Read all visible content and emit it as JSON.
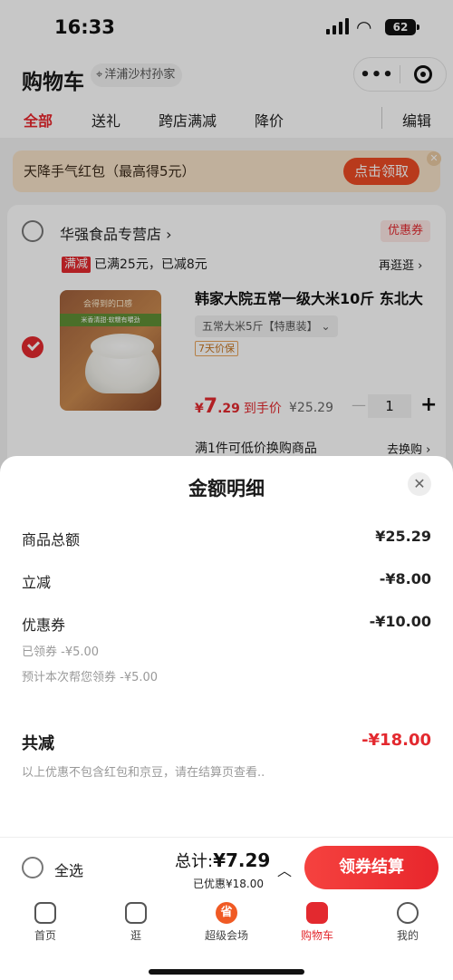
{
  "status_bar": {
    "time": "16:33",
    "battery": "62"
  },
  "header": {
    "title": "购物车",
    "location": "洋浦沙村孙家",
    "tabs": [
      {
        "label": "全部",
        "active": true
      },
      {
        "label": "送礼"
      },
      {
        "label": "跨店满减"
      },
      {
        "label": "降价"
      }
    ],
    "edit_label": "编辑"
  },
  "promo_banner": {
    "text": "天降手气红包（最高得5元）",
    "button": "点击领取"
  },
  "store": {
    "name": "华强食品专营店 ›",
    "coupon_tag": "优惠券",
    "full_reduction_tag": "满减",
    "full_reduction_text": "已满25元，已减8元",
    "more_link": "再逛逛 ›",
    "item": {
      "image_text_1": "会得到的口感",
      "image_text_2": "米香清甜·软糯有嚼劲",
      "name": "韩家大院五常一级大米10斤 东北大",
      "spec": "五常大米5斤【特惠装】 ⌄",
      "protect_tag": "7天价保",
      "price_symbol": "¥",
      "price_int": "7",
      "price_dec": ".29",
      "price_label": "到手价",
      "orig_price": "¥25.29",
      "qty": "1"
    },
    "swap_text": "满1件可低价换购商品",
    "swap_link": "去换购 ›"
  },
  "sheet": {
    "title": "金额明细",
    "rows": [
      {
        "label": "商品总额",
        "value": "¥25.29"
      },
      {
        "label": "立减",
        "value": "-¥8.00"
      },
      {
        "label": "优惠券",
        "value": "-¥10.00"
      }
    ],
    "coupon_sub_1": "已领券 -¥5.00",
    "coupon_sub_2": "预计本次帮您领券 -¥5.00",
    "total_label": "共减",
    "total_value": "-¥18.00",
    "note": "以上优惠不包含红包和京豆，请在结算页查看.."
  },
  "checkout": {
    "select_all": "全选",
    "total_prefix": "总计:",
    "total_amount": "¥7.29",
    "saved": "已优惠¥18.00",
    "settle_button": "领券结算"
  },
  "tabbar": [
    {
      "label": "首页"
    },
    {
      "label": "逛"
    },
    {
      "label": "超级会场",
      "icon_text": "省"
    },
    {
      "label": "购物车",
      "active": true
    },
    {
      "label": "我的"
    }
  ],
  "colors": {
    "accent": "#e3292f",
    "promo_bg": "#f7e2c8",
    "promo_btn": "#ec4b24"
  }
}
